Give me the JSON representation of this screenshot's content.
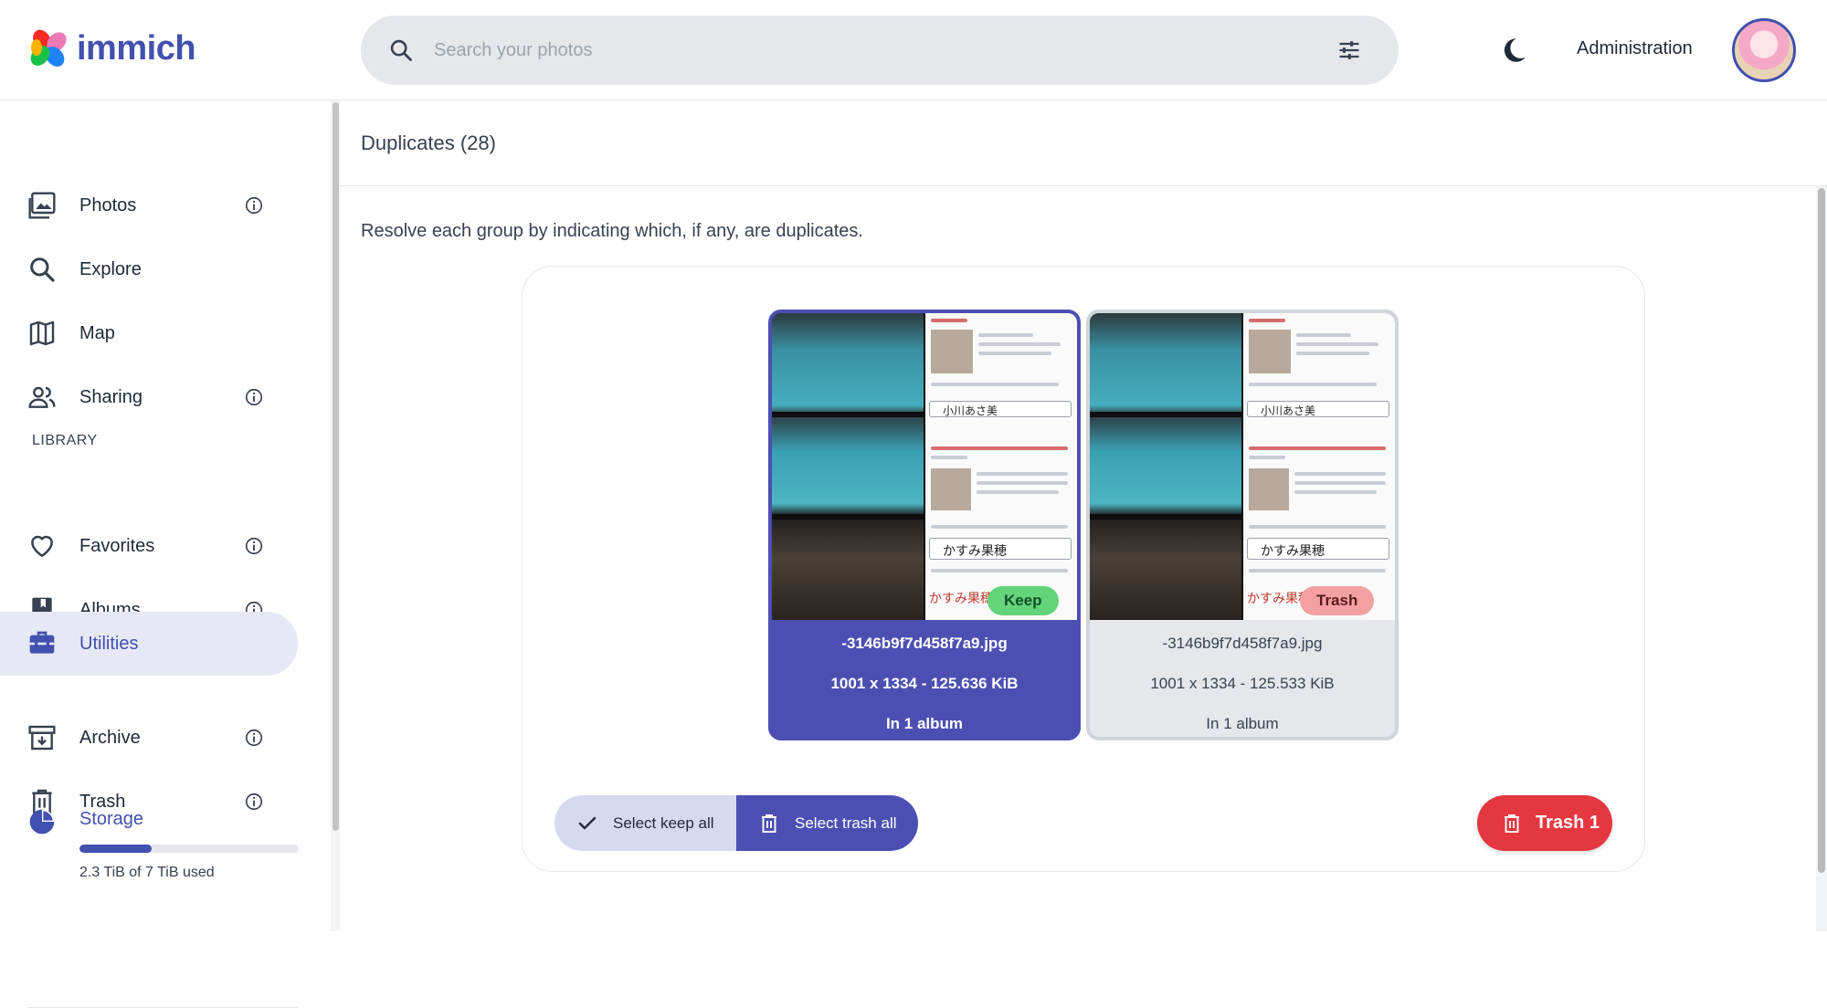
{
  "app": {
    "name": "immich",
    "brand_color": "#4250af"
  },
  "header": {
    "search_placeholder": "Search your photos",
    "admin_label": "Administration"
  },
  "sidebar": {
    "items": [
      {
        "label": "Photos",
        "icon": "photos-icon",
        "info": true
      },
      {
        "label": "Explore",
        "icon": "search-icon",
        "info": false
      },
      {
        "label": "Map",
        "icon": "map-icon",
        "info": false
      },
      {
        "label": "Sharing",
        "icon": "people-icon",
        "info": true
      }
    ],
    "library_heading": "LIBRARY",
    "library_items": [
      {
        "label": "Favorites",
        "icon": "heart-icon",
        "info": true
      },
      {
        "label": "Albums",
        "icon": "album-icon",
        "info": true
      },
      {
        "label": "Utilities",
        "icon": "toolbox-icon",
        "info": false,
        "active": true
      },
      {
        "label": "Archive",
        "icon": "archive-icon",
        "info": true
      },
      {
        "label": "Trash",
        "icon": "trash-icon",
        "info": true
      }
    ],
    "storage": {
      "label": "Storage",
      "used_text": "2.3 TiB of 7 TiB used",
      "used_fraction": 0.33
    }
  },
  "main": {
    "title": "Duplicates (28)",
    "description": "Resolve each group by indicating which, if any, are duplicates.",
    "assets": [
      {
        "filename": "-3146b9f7d458f7a9.jpg",
        "dims_size": "1001 x 1334 - 125.636 KiB",
        "albums": "In 1 album",
        "status": "Keep"
      },
      {
        "filename": "-3146b9f7d458f7a9.jpg",
        "dims_size": "1001 x 1334 - 125.533 KiB",
        "albums": "In 1 album",
        "status": "Trash"
      }
    ],
    "thumb_text": {
      "query1": "小川あさ美",
      "query2": "かすみ果穂",
      "result": "かすみ果穂"
    },
    "buttons": {
      "select_keep_all": "Select keep all",
      "select_trash_all": "Select trash all",
      "trash": "Trash 1"
    }
  }
}
